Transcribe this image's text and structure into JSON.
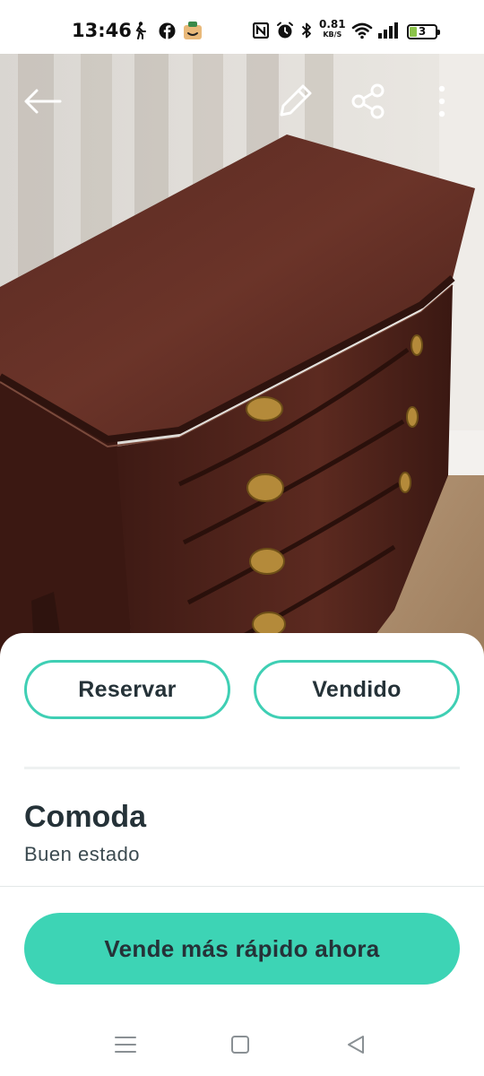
{
  "status_bar": {
    "time": "13:46",
    "net_speed_value": "0.81",
    "net_speed_unit": "KB/S",
    "battery_level": "3",
    "icons": [
      "walking-icon",
      "facebook-icon",
      "amazon-icon",
      "nfc-icon",
      "alarm-icon",
      "bluetooth-icon",
      "wifi-icon",
      "signal-icon",
      "battery-icon"
    ]
  },
  "toolbar": {
    "icons": [
      "back-arrow-icon",
      "edit-pencil-icon",
      "share-icon",
      "more-vertical-icon"
    ]
  },
  "gallery": {
    "page_count": 4,
    "active_index": 1
  },
  "actions": {
    "reserve_label": "Reservar",
    "sold_label": "Vendido"
  },
  "listing": {
    "title": "Comoda",
    "condition": "Buen estado"
  },
  "cta": {
    "label": "Vende más rápido ahora"
  },
  "colors": {
    "accent": "#3dd4b5",
    "accent_border": "#3fcfb4",
    "text_primary": "#253238"
  },
  "navigation": {
    "icons": [
      "menu-icon",
      "home-square-icon",
      "back-triangle-icon"
    ]
  }
}
